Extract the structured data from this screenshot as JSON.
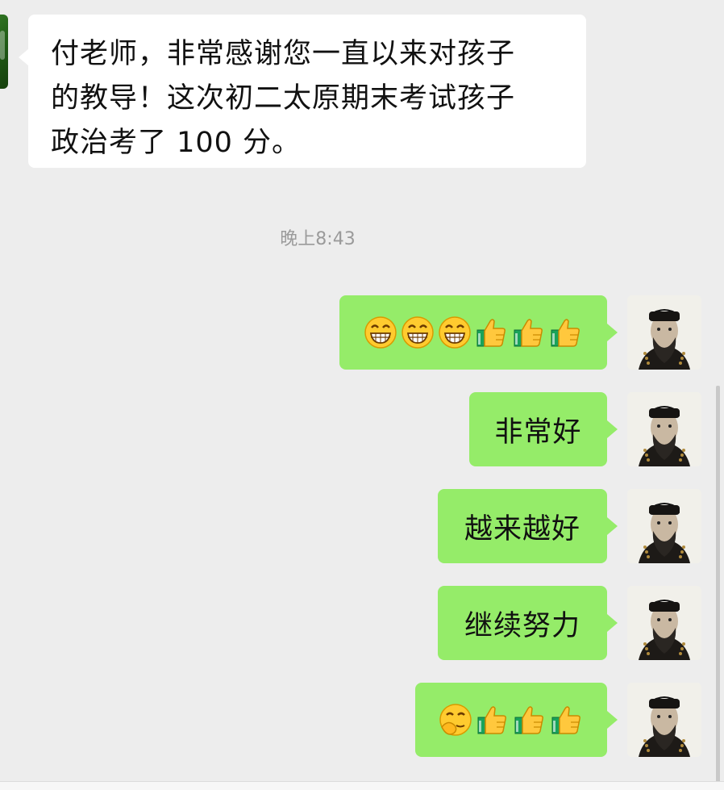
{
  "incoming_message": {
    "lines": [
      "付老师，非常感谢您一直以来对孩子",
      "的教导！这次初二太原期末考试孩子",
      "政治考了 100 分。"
    ]
  },
  "timestamp": "晚上8:43",
  "outgoing_messages": [
    {
      "type": "emoji",
      "icons": [
        "grin-icon",
        "grin-icon",
        "grin-icon",
        "thumbs-up-icon",
        "thumbs-up-icon",
        "thumbs-up-icon"
      ]
    },
    {
      "type": "text",
      "text": "非常好"
    },
    {
      "type": "text",
      "text": "越来越好"
    },
    {
      "type": "text",
      "text": "继续努力"
    },
    {
      "type": "emoji",
      "icons": [
        "shy-laugh-icon",
        "thumbs-up-icon",
        "thumbs-up-icon",
        "thumbs-up-icon"
      ]
    }
  ],
  "colors": {
    "background": "#ededed",
    "incoming_bubble": "#ffffff",
    "outgoing_bubble": "#95ec69",
    "timestamp_text": "#9a9a9a"
  }
}
